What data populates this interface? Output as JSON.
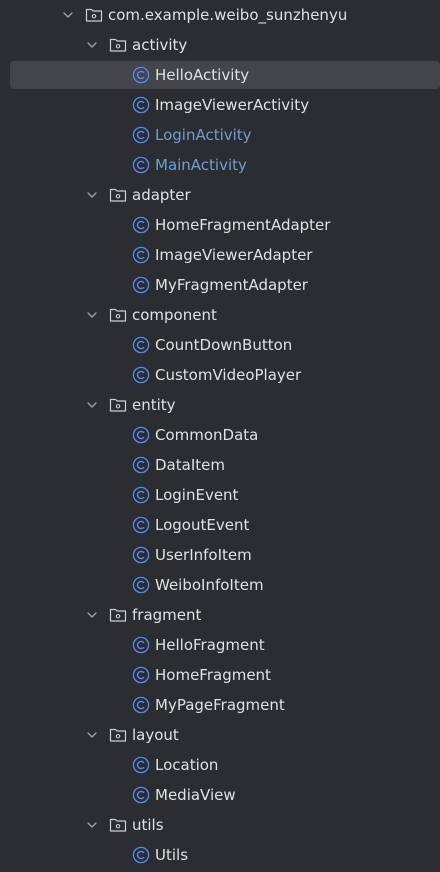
{
  "tree": [
    {
      "type": "package",
      "depth": 0,
      "label": "com.example.weibo_sunzhenyu",
      "icon": "package-folder-icon",
      "expanded": true
    },
    {
      "type": "package",
      "depth": 1,
      "label": "activity",
      "icon": "package-folder-icon",
      "expanded": true
    },
    {
      "type": "class",
      "depth": 2,
      "label": "HelloActivity",
      "icon": "class-icon",
      "selected": true
    },
    {
      "type": "class",
      "depth": 2,
      "label": "ImageViewerActivity",
      "icon": "class-icon"
    },
    {
      "type": "class",
      "depth": 2,
      "label": "LoginActivity",
      "icon": "class-icon",
      "modified": true
    },
    {
      "type": "class",
      "depth": 2,
      "label": "MainActivity",
      "icon": "class-icon",
      "modified": true
    },
    {
      "type": "package",
      "depth": 1,
      "label": "adapter",
      "icon": "package-folder-icon",
      "expanded": true
    },
    {
      "type": "class",
      "depth": 2,
      "label": "HomeFragmentAdapter",
      "icon": "class-icon"
    },
    {
      "type": "class",
      "depth": 2,
      "label": "ImageViewerAdapter",
      "icon": "class-icon"
    },
    {
      "type": "class",
      "depth": 2,
      "label": "MyFragmentAdapter",
      "icon": "class-icon"
    },
    {
      "type": "package",
      "depth": 1,
      "label": "component",
      "icon": "package-folder-icon",
      "expanded": true
    },
    {
      "type": "class",
      "depth": 2,
      "label": "CountDownButton",
      "icon": "class-icon"
    },
    {
      "type": "class",
      "depth": 2,
      "label": "CustomVideoPlayer",
      "icon": "class-icon"
    },
    {
      "type": "package",
      "depth": 1,
      "label": "entity",
      "icon": "package-folder-icon",
      "expanded": true
    },
    {
      "type": "class",
      "depth": 2,
      "label": "CommonData",
      "icon": "class-icon"
    },
    {
      "type": "class",
      "depth": 2,
      "label": "DataItem",
      "icon": "class-icon"
    },
    {
      "type": "class",
      "depth": 2,
      "label": "LoginEvent",
      "icon": "class-icon"
    },
    {
      "type": "class",
      "depth": 2,
      "label": "LogoutEvent",
      "icon": "class-icon"
    },
    {
      "type": "class",
      "depth": 2,
      "label": "UserInfoItem",
      "icon": "class-icon"
    },
    {
      "type": "class",
      "depth": 2,
      "label": "WeiboInfoItem",
      "icon": "class-icon"
    },
    {
      "type": "package",
      "depth": 1,
      "label": "fragment",
      "icon": "package-folder-icon",
      "expanded": true
    },
    {
      "type": "class",
      "depth": 2,
      "label": "HelloFragment",
      "icon": "class-icon"
    },
    {
      "type": "class",
      "depth": 2,
      "label": "HomeFragment",
      "icon": "class-icon"
    },
    {
      "type": "class",
      "depth": 2,
      "label": "MyPageFragment",
      "icon": "class-icon"
    },
    {
      "type": "package",
      "depth": 1,
      "label": "layout",
      "icon": "package-folder-icon",
      "expanded": true
    },
    {
      "type": "class",
      "depth": 2,
      "label": "Location",
      "icon": "class-icon"
    },
    {
      "type": "class",
      "depth": 2,
      "label": "MediaView",
      "icon": "class-icon"
    },
    {
      "type": "package",
      "depth": 1,
      "label": "utils",
      "icon": "package-folder-icon",
      "expanded": true
    },
    {
      "type": "class",
      "depth": 2,
      "label": "Utils",
      "icon": "class-icon"
    }
  ],
  "colors": {
    "background": "#2b2d30",
    "selection": "#43454a",
    "text": "#dfe1e5",
    "modified_text": "#6f9fce",
    "class_icon": "#548af7",
    "chevron": "#9da0a8",
    "folder_icon": "#ced0d6"
  }
}
